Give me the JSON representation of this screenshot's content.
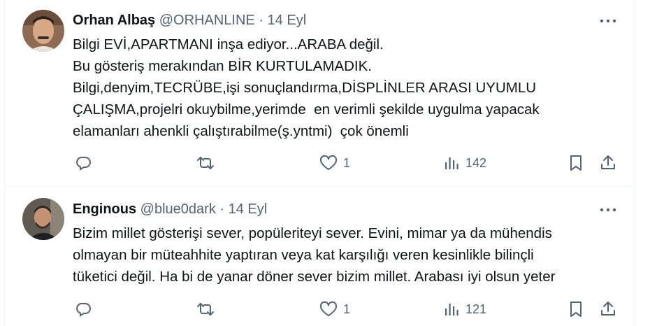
{
  "tweets": [
    {
      "display_name": "Orhan Albaş",
      "handle": "@ORHANLINE",
      "separator": "·",
      "date": "14 Eyl",
      "lines": [
        "Bilgi EVİ,APARTMANI inşa ediyor...ARABA değil.",
        "Bu gösteriş merakından BİR KURTULAMADIK.",
        "Bilgi,denyim,TECRÜBE,işi sonuçlandırma,DİSPLİNLER ARASI UYUMLU",
        "ÇALIŞMA,projelri okuybilme,yerimde  en verimli şekilde uygulma yapacak",
        "elamanları ahenkli çalıştırabilme(ş.yntmi)  çok önemli"
      ],
      "actions": {
        "likes": "1",
        "views": "142"
      },
      "icons": [
        "reply-icon",
        "retweet-icon",
        "like-icon",
        "views-icon",
        "bookmark-icon",
        "share-icon",
        "more-icon"
      ]
    },
    {
      "display_name": "Enginous",
      "handle": "@blue0dark",
      "separator": "·",
      "date": "14 Eyl",
      "lines": [
        "Bizim millet gösterişi sever, popüleriteyi sever. Evini, mimar ya da mühendis",
        "olmayan bir müteahhite yaptıran veya kat karşılığı veren kesinlikle bilinçli",
        "tüketici değil. Ha bi de yanar döner sever bizim millet. Arabası iyi olsun yeter"
      ],
      "actions": {
        "likes": "1",
        "views": "121"
      },
      "icons": [
        "reply-icon",
        "retweet-icon",
        "like-icon",
        "views-icon",
        "bookmark-icon",
        "share-icon",
        "more-icon"
      ]
    }
  ],
  "colors": {
    "text": "#0f1419",
    "secondary": "#536471",
    "border": "#eff3f4"
  }
}
